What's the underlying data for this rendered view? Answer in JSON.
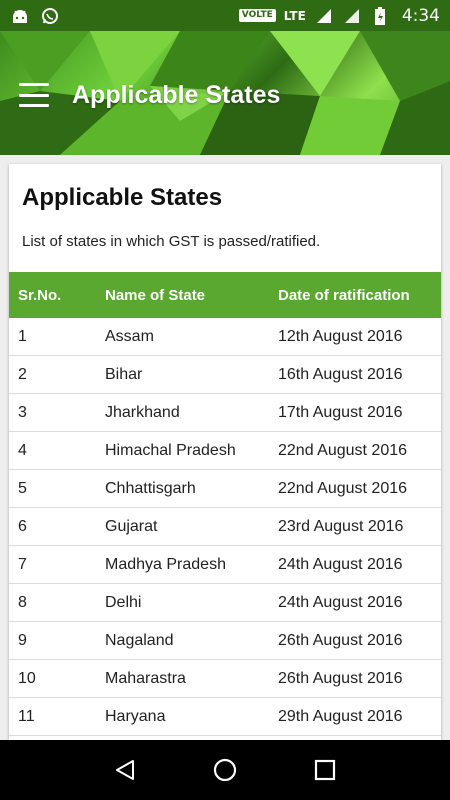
{
  "status_bar": {
    "volte": "VOLTE",
    "network": "LTE",
    "time": "4:34",
    "icons": [
      "android-icon",
      "whatsapp-icon",
      "signal-icon",
      "signal-icon",
      "battery-charging-icon"
    ]
  },
  "app_bar": {
    "title": "Applicable States",
    "menu_icon": "hamburger-menu-icon"
  },
  "card": {
    "title": "Applicable States",
    "subtitle": "List of states in which GST is passed/ratified."
  },
  "table": {
    "headers": [
      "Sr.No.",
      "Name of State",
      "Date of ratification"
    ],
    "rows": [
      [
        "1",
        "Assam",
        "12th August 2016"
      ],
      [
        "2",
        "Bihar",
        "16th August 2016"
      ],
      [
        "3",
        "Jharkhand",
        "17th August 2016"
      ],
      [
        "4",
        "Himachal Pradesh",
        "22nd August 2016"
      ],
      [
        "5",
        "Chhattisgarh",
        "22nd August 2016"
      ],
      [
        "6",
        "Gujarat",
        "23rd August 2016"
      ],
      [
        "7",
        "Madhya Pradesh",
        "24th August 2016"
      ],
      [
        "8",
        "Delhi",
        "24th August 2016"
      ],
      [
        "9",
        "Nagaland",
        "26th August 2016"
      ],
      [
        "10",
        "Maharastra",
        "26th August 2016"
      ],
      [
        "11",
        "Haryana",
        "29th August 2016"
      ]
    ]
  },
  "nav_bar": {
    "icons": [
      "back-icon",
      "home-icon",
      "recents-icon"
    ]
  },
  "colors": {
    "header_green": "#5aa830",
    "status_bar": "#2f6b13"
  }
}
